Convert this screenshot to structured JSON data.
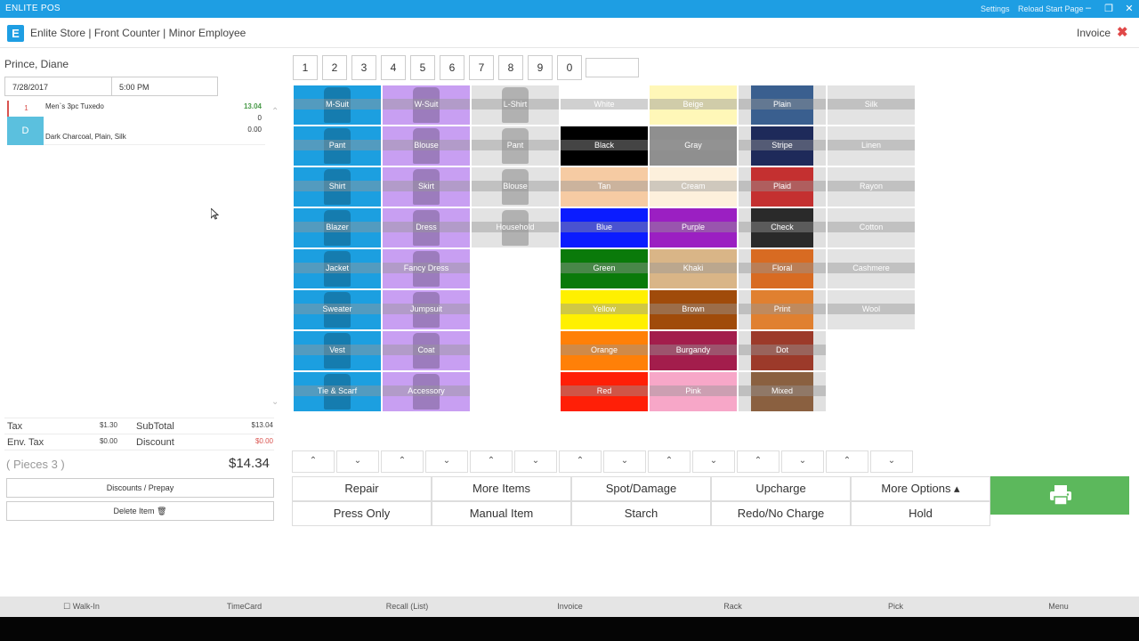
{
  "app": {
    "name": "ENLITE POS",
    "settings": "Settings",
    "reload": "Reload Start Page",
    "minimize_icon": "–",
    "restore_icon": "❐",
    "close_icon": "✕"
  },
  "header": {
    "logo_letter": "E",
    "store_title": "Enlite Store | Front Counter | Minor Employee",
    "invoice_label": "Invoice",
    "close_glyph": "✖"
  },
  "customer": {
    "name": "Prince, Diane",
    "date": "7/28/2017",
    "time": "5:00 PM"
  },
  "order_items": [
    {
      "qty": "1",
      "type_code": "D",
      "name": "Men`s 3pc Tuxedo",
      "description": "Dark Charcoal, Plain, Silk",
      "price": "13.04",
      "sub1": "0",
      "sub2": "0.00"
    }
  ],
  "totals": {
    "tax_label": "Tax",
    "tax": "$1.30",
    "subtotal_label": "SubTotal",
    "subtotal": "$13.04",
    "env_tax_label": "Env. Tax",
    "env_tax": "$0.00",
    "discount_label": "Discount",
    "discount": "$0.00",
    "pieces": "( Pieces 3 )",
    "total": "$14.34"
  },
  "left_buttons": {
    "discounts": "Discounts / Prepay",
    "delete": "Delete Item 🗑"
  },
  "numpad": [
    "1",
    "2",
    "3",
    "4",
    "5",
    "6",
    "7",
    "8",
    "9",
    "0"
  ],
  "colors": {
    "titlebar": "#1e9ee3",
    "accent_blue": "#1c9fe0",
    "accent_purple": "#c89ff2",
    "print_green": "#5cb85c",
    "qty_red": "#d9534f"
  },
  "grid_columns": [
    {
      "items": [
        {
          "label": "M-Suit",
          "bg": "#1c9fe0",
          "swatch": ""
        },
        {
          "label": "Pant",
          "bg": "#1c9fe0",
          "swatch": ""
        },
        {
          "label": "Shirt",
          "bg": "#1c9fe0",
          "swatch": ""
        },
        {
          "label": "Blazer",
          "bg": "#1c9fe0",
          "swatch": ""
        },
        {
          "label": "Jacket",
          "bg": "#1c9fe0",
          "swatch": ""
        },
        {
          "label": "Sweater",
          "bg": "#1c9fe0",
          "swatch": ""
        },
        {
          "label": "Vest",
          "bg": "#1c9fe0",
          "swatch": ""
        },
        {
          "label": "Tie & Scarf",
          "bg": "#1c9fe0",
          "swatch": ""
        }
      ]
    },
    {
      "items": [
        {
          "label": "W-Suit",
          "bg": "#c89ff2",
          "swatch": ""
        },
        {
          "label": "Blouse",
          "bg": "#c89ff2",
          "swatch": ""
        },
        {
          "label": "Skirt",
          "bg": "#c89ff2",
          "swatch": ""
        },
        {
          "label": "Dress",
          "bg": "#c89ff2",
          "swatch": ""
        },
        {
          "label": "Fancy Dress",
          "bg": "#c89ff2",
          "swatch": ""
        },
        {
          "label": "Jumpsuit",
          "bg": "#c89ff2",
          "swatch": ""
        },
        {
          "label": "Coat",
          "bg": "#c89ff2",
          "swatch": ""
        },
        {
          "label": "Accessory",
          "bg": "#c89ff2",
          "swatch": ""
        }
      ]
    },
    {
      "items": [
        {
          "label": "L-Shirt",
          "bg": "#e3e3e3",
          "swatch": ""
        },
        {
          "label": "Pant",
          "bg": "#e3e3e3",
          "swatch": ""
        },
        {
          "label": "Blouse",
          "bg": "#e3e3e3",
          "swatch": ""
        },
        {
          "label": "Household",
          "bg": "#e3e3e3",
          "swatch": ""
        }
      ]
    },
    {
      "items": [
        {
          "label": "White",
          "bg": "#ffffff",
          "swatch": ""
        },
        {
          "label": "Black",
          "bg": "#000000",
          "swatch": ""
        },
        {
          "label": "Tan",
          "bg": "#f6cba3",
          "swatch": ""
        },
        {
          "label": "Blue",
          "bg": "#0b1cff",
          "swatch": ""
        },
        {
          "label": "Green",
          "bg": "#0a7a0a",
          "swatch": ""
        },
        {
          "label": "Yellow",
          "bg": "#fff000",
          "swatch": ""
        },
        {
          "label": "Orange",
          "bg": "#ff8008",
          "swatch": ""
        },
        {
          "label": "Red",
          "bg": "#ff1f07",
          "swatch": ""
        }
      ]
    },
    {
      "items": [
        {
          "label": "Beige",
          "bg": "#fff7b8",
          "swatch": ""
        },
        {
          "label": "Gray",
          "bg": "#8f8f8f",
          "swatch": ""
        },
        {
          "label": "Cream",
          "bg": "#fdf0dc",
          "swatch": ""
        },
        {
          "label": "Purple",
          "bg": "#9b1fc2",
          "swatch": ""
        },
        {
          "label": "Khaki",
          "bg": "#d9b587",
          "swatch": ""
        },
        {
          "label": "Brown",
          "bg": "#a04b0a",
          "swatch": ""
        },
        {
          "label": "Burgandy",
          "bg": "#a31d4c",
          "swatch": ""
        },
        {
          "label": "Pink",
          "bg": "#f7a7c8",
          "swatch": ""
        }
      ]
    },
    {
      "items": [
        {
          "label": "Plain",
          "bg": "#e0e0e0",
          "swatch": "#3a5f8f"
        },
        {
          "label": "Stripe",
          "bg": "#e0e0e0",
          "swatch": "#1e2a5a"
        },
        {
          "label": "Plaid",
          "bg": "#e0e0e0",
          "swatch": "#c43030"
        },
        {
          "label": "Check",
          "bg": "#e0e0e0",
          "swatch": "#2a2a2a"
        },
        {
          "label": "Floral",
          "bg": "#e0e0e0",
          "swatch": "#d86b22"
        },
        {
          "label": "Print",
          "bg": "#e0e0e0",
          "swatch": "#e08030"
        },
        {
          "label": "Dot",
          "bg": "#e0e0e0",
          "swatch": "#9c3a2a"
        },
        {
          "label": "Mixed",
          "bg": "#e0e0e0",
          "swatch": "#8a6040"
        }
      ]
    },
    {
      "items": [
        {
          "label": "Silk",
          "bg": "#e3e3e3",
          "swatch": ""
        },
        {
          "label": "Linen",
          "bg": "#e3e3e3",
          "swatch": ""
        },
        {
          "label": "Rayon",
          "bg": "#e3e3e3",
          "swatch": ""
        },
        {
          "label": "Cotton",
          "bg": "#e3e3e3",
          "swatch": ""
        },
        {
          "label": "Cashmere",
          "bg": "#e3e3e3",
          "swatch": ""
        },
        {
          "label": "Wool",
          "bg": "#e3e3e3",
          "swatch": ""
        }
      ]
    }
  ],
  "scroll_arrows": {
    "up": "⌃",
    "down": "⌄"
  },
  "actions": [
    [
      "Repair",
      "More Items",
      "Spot/Damage",
      "Upcharge",
      "More Options ▴"
    ],
    [
      "Press Only",
      "Manual Item",
      "Starch",
      "Redo/No Charge",
      "Hold"
    ]
  ],
  "bottom_bar": [
    "☐ Walk-In",
    "TimeCard",
    "Recall (List)",
    "Invoice",
    "Rack",
    "Pick",
    "Menu"
  ]
}
